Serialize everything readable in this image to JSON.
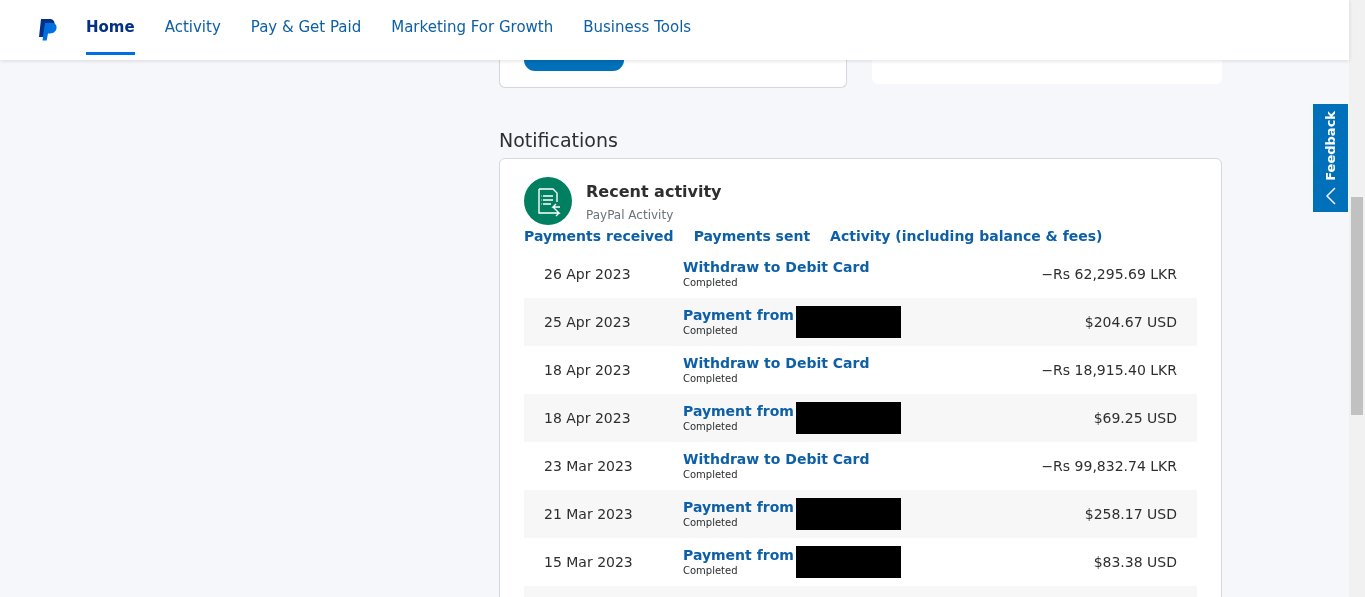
{
  "nav": [
    {
      "label": "Home",
      "selected": true
    },
    {
      "label": "Activity",
      "selected": false
    },
    {
      "label": "Pay & Get Paid",
      "selected": false
    },
    {
      "label": "Marketing For Growth",
      "selected": false
    },
    {
      "label": "Business Tools",
      "selected": false
    }
  ],
  "notifications": {
    "heading": "Notifications",
    "card_title": "Recent activity",
    "card_subtitle": "PayPal Activity",
    "links": [
      "Payments received",
      "Payments sent",
      "Activity (including balance & fees)"
    ],
    "rows": [
      {
        "date": "26 Apr 2023",
        "description": "Withdraw to Debit Card",
        "status": "Completed",
        "amount": "−Rs 62,295.69 LKR",
        "redacted": false
      },
      {
        "date": "25 Apr 2023",
        "description": "Payment from",
        "status": "Completed",
        "amount": "$204.67 USD",
        "redacted": true
      },
      {
        "date": "18 Apr 2023",
        "description": "Withdraw to Debit Card",
        "status": "Completed",
        "amount": "−Rs 18,915.40 LKR",
        "redacted": false
      },
      {
        "date": "18 Apr 2023",
        "description": "Payment from",
        "status": "Completed",
        "amount": "$69.25 USD",
        "redacted": true
      },
      {
        "date": "23 Mar 2023",
        "description": "Withdraw to Debit Card",
        "status": "Completed",
        "amount": "−Rs 99,832.74 LKR",
        "redacted": false
      },
      {
        "date": "21 Mar 2023",
        "description": "Payment from",
        "status": "Completed",
        "amount": "$258.17 USD",
        "redacted": true
      },
      {
        "date": "15 Mar 2023",
        "description": "Payment from",
        "status": "Completed",
        "amount": "$83.38 USD",
        "redacted": true
      }
    ]
  },
  "feedback": "Feedback"
}
